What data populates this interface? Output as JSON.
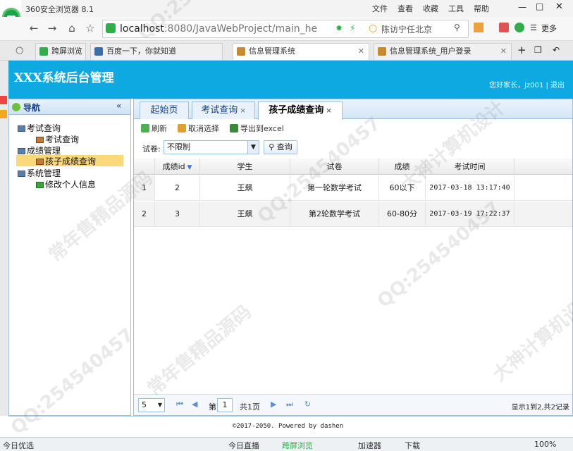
{
  "browser": {
    "title": "360安全浏览器 8.1",
    "menu": [
      "文件",
      "查看",
      "收藏",
      "工具",
      "帮助"
    ],
    "address_host": "localhost",
    "address_rest": ":8080/JavaWebProject/main_he",
    "search_suggestion": "陈访宁任北京",
    "more_label": "更多",
    "tabs": [
      "跨屏浏览",
      "百度一下，你就知道",
      "信息管理系统",
      "信息管理系统_用户登录"
    ],
    "status": {
      "left": "今日优选",
      "items": [
        "今日直播",
        "跨屏浏览",
        "加速器",
        "下载"
      ],
      "zoom": "100%"
    }
  },
  "app": {
    "title": "XXX系统后台管理",
    "greeting": "您好家长，jz001",
    "logout": "退出",
    "nav": {
      "title": "导航",
      "items": [
        {
          "label": "考试查询",
          "level": 0
        },
        {
          "label": "考试查询",
          "level": 1
        },
        {
          "label": "成绩管理",
          "level": 0
        },
        {
          "label": "孩子成绩查询",
          "level": 1,
          "selected": true
        },
        {
          "label": "系统管理",
          "level": 0
        },
        {
          "label": "修改个人信息",
          "level": 1
        }
      ]
    },
    "tabs": [
      {
        "label": "起始页"
      },
      {
        "label": "考试查询"
      },
      {
        "label": "孩子成绩查询",
        "active": true
      }
    ],
    "toolbar": {
      "refresh": "刷新",
      "deselect": "取消选择",
      "export": "导出到excel"
    },
    "filter": {
      "label": "试卷:",
      "value": "不限制",
      "query": "查询"
    },
    "grid": {
      "columns": [
        "成绩id",
        "学生",
        "试卷",
        "成绩",
        "考试时间"
      ],
      "rows": [
        [
          "1",
          "2",
          "王飙",
          "第一轮数学考试",
          "60以下",
          "2017-03-18 13:17:40"
        ],
        [
          "2",
          "3",
          "王飙",
          "第2轮数学考试",
          "60-80分",
          "2017-03-19 17:22:37"
        ]
      ]
    },
    "pager": {
      "page_size": "5",
      "page_label": "第",
      "page_value": "1",
      "total_pages": "共1页",
      "summary": "显示1到2,共2记录"
    },
    "footer": "©2017-2050. Powered by dashen"
  },
  "watermarks": [
    "QQ:254540457",
    "常年售精品源码",
    "大神计算机设计"
  ],
  "colors": {
    "header": "#0da9e0",
    "border": "#9ec0e0",
    "selected": "#fbd97b"
  }
}
